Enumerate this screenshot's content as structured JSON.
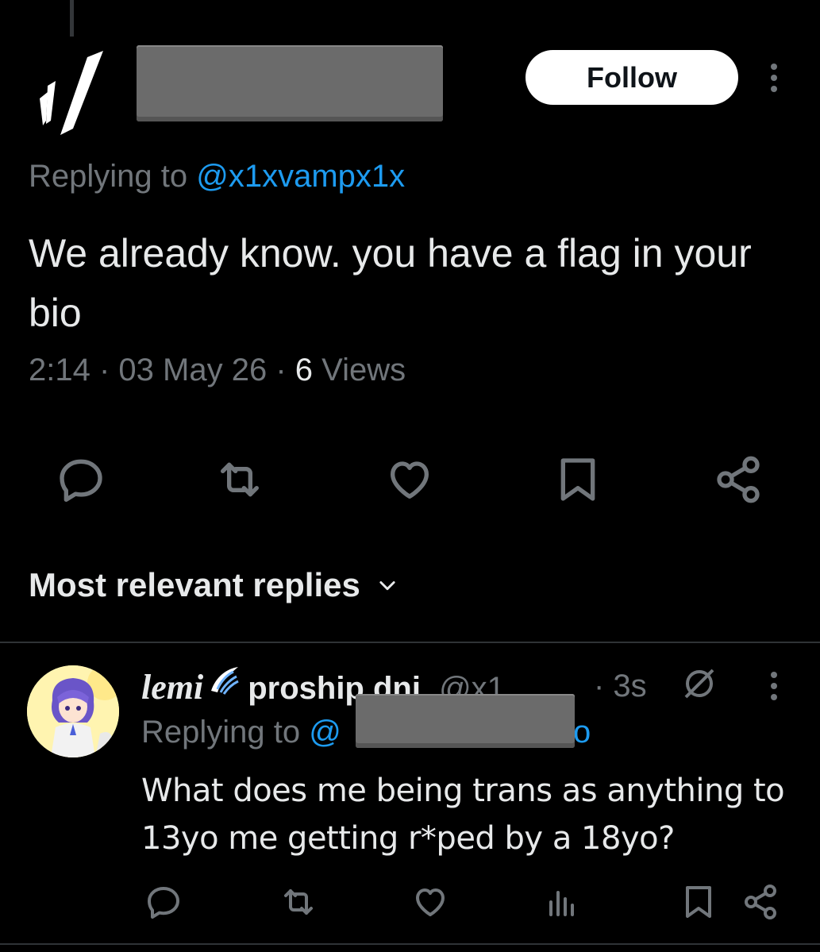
{
  "main_tweet": {
    "follow_label": "Follow",
    "replying_prefix": "Replying to ",
    "replying_handle": "@x1xvampx1x",
    "text": "We already know. you have a flag in your bio",
    "time": "2:14",
    "date": "03 May 26",
    "views_count": "6",
    "views_label": " Views",
    "actions": [
      "reply-icon",
      "retweet-icon",
      "heart-icon",
      "bookmark-icon",
      "share-icon"
    ]
  },
  "replies_section": {
    "title": "Most relevant replies"
  },
  "reply": {
    "display_name": "lemi",
    "display_name_rest": "proship dni.",
    "handle": "@x1...",
    "time": "· 3s",
    "replying_prefix": "Replying to ",
    "replying_handle_start": "@",
    "replying_handle_end": "o",
    "text": "What does me being trans as anything to 13yo me getting r*ped by a 18yo?",
    "actions": [
      "reply-icon",
      "retweet-icon",
      "heart-icon",
      "views-icon",
      "bookmark-icon",
      "share-icon"
    ]
  },
  "colors": {
    "background": "#000000",
    "text_primary": "#e7e9ea",
    "text_secondary": "#71767b",
    "accent": "#1d9bf0",
    "redaction": "#6b6b6b"
  }
}
